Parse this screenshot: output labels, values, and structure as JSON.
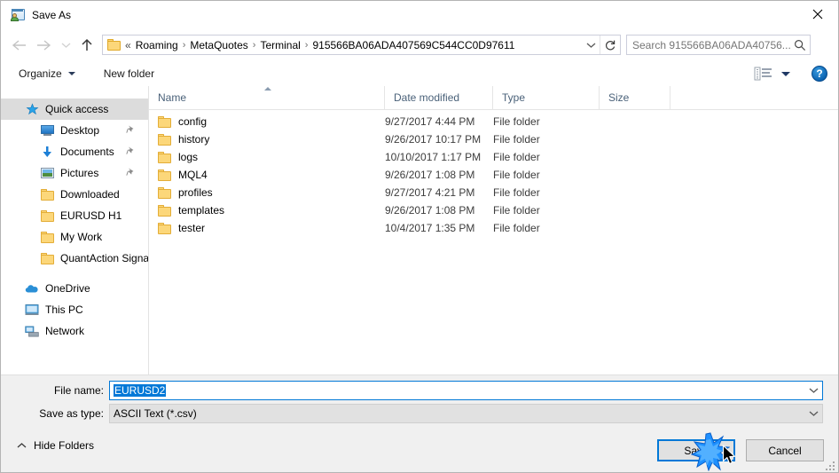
{
  "window": {
    "title": "Save As",
    "title_icon": "save-as-app-icon",
    "close_icon": "close-icon"
  },
  "nav": {
    "back_icon": "back-arrow-icon",
    "forward_icon": "forward-arrow-icon",
    "recent_icon": "chevron-down-icon",
    "up_icon": "up-arrow-icon",
    "address": {
      "folder_icon": "folder-icon",
      "prefix": "«",
      "crumbs": [
        "Roaming",
        "MetaQuotes",
        "Terminal",
        "915566BA06ADA407569C544CC0D97611"
      ],
      "separator": "›",
      "dropdown_icon": "chevron-down-icon",
      "refresh_icon": "refresh-icon"
    },
    "search": {
      "placeholder": "Search 915566BA06ADA40756...",
      "icon": "search-icon"
    }
  },
  "toolbar": {
    "organize_label": "Organize",
    "new_folder_label": "New folder",
    "view_icon": "view-layout-icon",
    "view_caret_icon": "chevron-down-icon",
    "help_label": "?",
    "help_icon": "help-icon"
  },
  "sidebar": {
    "items": [
      {
        "label": "Quick access",
        "icon": "star-icon",
        "level": 0,
        "selected": true,
        "pinned": false
      },
      {
        "label": "Desktop",
        "icon": "monitor-icon",
        "level": 1,
        "selected": false,
        "pinned": true
      },
      {
        "label": "Documents",
        "icon": "download-icon",
        "level": 1,
        "selected": false,
        "pinned": true
      },
      {
        "label": "Pictures",
        "icon": "picture-icon",
        "level": 1,
        "selected": false,
        "pinned": true
      },
      {
        "label": "Downloaded",
        "icon": "folder-icon",
        "level": 1,
        "selected": false,
        "pinned": false
      },
      {
        "label": "EURUSD H1",
        "icon": "folder-icon",
        "level": 1,
        "selected": false,
        "pinned": false
      },
      {
        "label": "My Work",
        "icon": "folder-icon",
        "level": 1,
        "selected": false,
        "pinned": false
      },
      {
        "label": "QuantAction Signal",
        "icon": "folder-icon",
        "level": 1,
        "selected": false,
        "pinned": false
      },
      {
        "label": "OneDrive",
        "icon": "cloud-icon",
        "level": 0,
        "selected": false,
        "pinned": false
      },
      {
        "label": "This PC",
        "icon": "computer-icon",
        "level": 0,
        "selected": false,
        "pinned": false
      },
      {
        "label": "Network",
        "icon": "network-icon",
        "level": 0,
        "selected": false,
        "pinned": false
      }
    ]
  },
  "filelist": {
    "columns": [
      "Name",
      "Date modified",
      "Type",
      "Size"
    ],
    "sort_column": "Name",
    "sort_direction": "ascending",
    "rows": [
      {
        "name": "config",
        "date": "9/27/2017 4:44 PM",
        "type": "File folder",
        "size": ""
      },
      {
        "name": "history",
        "date": "9/26/2017 10:17 PM",
        "type": "File folder",
        "size": ""
      },
      {
        "name": "logs",
        "date": "10/10/2017 1:17 PM",
        "type": "File folder",
        "size": ""
      },
      {
        "name": "MQL4",
        "date": "9/26/2017 1:08 PM",
        "type": "File folder",
        "size": ""
      },
      {
        "name": "profiles",
        "date": "9/27/2017 4:21 PM",
        "type": "File folder",
        "size": ""
      },
      {
        "name": "templates",
        "date": "9/26/2017 1:08 PM",
        "type": "File folder",
        "size": ""
      },
      {
        "name": "tester",
        "date": "10/4/2017 1:35 PM",
        "type": "File folder",
        "size": ""
      }
    ]
  },
  "form": {
    "filename_label": "File name:",
    "filename_value": "EURUSD2",
    "filetype_label": "Save as type:",
    "filetype_value": "ASCII Text (*.csv)",
    "dropdown_icon": "chevron-down-icon"
  },
  "footer": {
    "hide_folders_label": "Hide Folders",
    "hide_folders_icon": "chevron-up-icon",
    "save_label": "Save",
    "cancel_label": "Cancel",
    "resize_grip_icon": "resize-grip-icon",
    "cursor_icon": "mouse-pointer-icon",
    "click_burst_icon": "click-burst-icon"
  },
  "colors": {
    "accent": "#0078d7",
    "folder_yellow": "#fcd77a",
    "header_text": "#4a6179",
    "panel_bg": "#f0f0f0"
  }
}
